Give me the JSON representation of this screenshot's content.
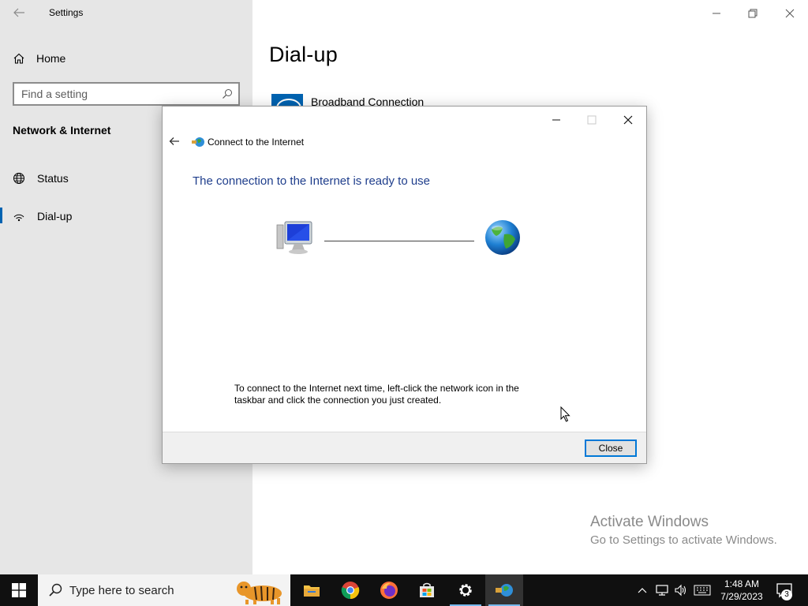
{
  "app": {
    "title": "Settings"
  },
  "sidebar": {
    "home_label": "Home",
    "search_placeholder": "Find a setting",
    "section_title": "Network & Internet",
    "items": [
      {
        "label": "Status",
        "icon": "globe-icon",
        "active": false
      },
      {
        "label": "Dial-up",
        "icon": "dialup-icon",
        "active": true
      }
    ]
  },
  "main": {
    "page_title": "Dial-up",
    "connection_name": "Broadband Connection"
  },
  "dialog": {
    "title": "Connect to the Internet",
    "heading": "The connection to the Internet is ready to use",
    "info": "To connect to the Internet next time, left-click the network icon in the taskbar and click the connection you just created.",
    "close_button": "Close"
  },
  "watermark": {
    "title": "Activate Windows",
    "subtitle": "Go to Settings to activate Windows."
  },
  "taskbar": {
    "search_placeholder": "Type here to search",
    "apps": [
      "file-explorer-icon",
      "chrome-icon",
      "firefox-icon",
      "store-icon",
      "settings-icon",
      "connect-wizard-icon"
    ],
    "clock": {
      "time": "1:48 AM",
      "date": "7/29/2023"
    },
    "notification_count": "3"
  },
  "colors": {
    "accent": "#0063b1",
    "heading": "#1f3e8c",
    "taskbar": "#101010",
    "sidebar": "#e6e6e6"
  }
}
